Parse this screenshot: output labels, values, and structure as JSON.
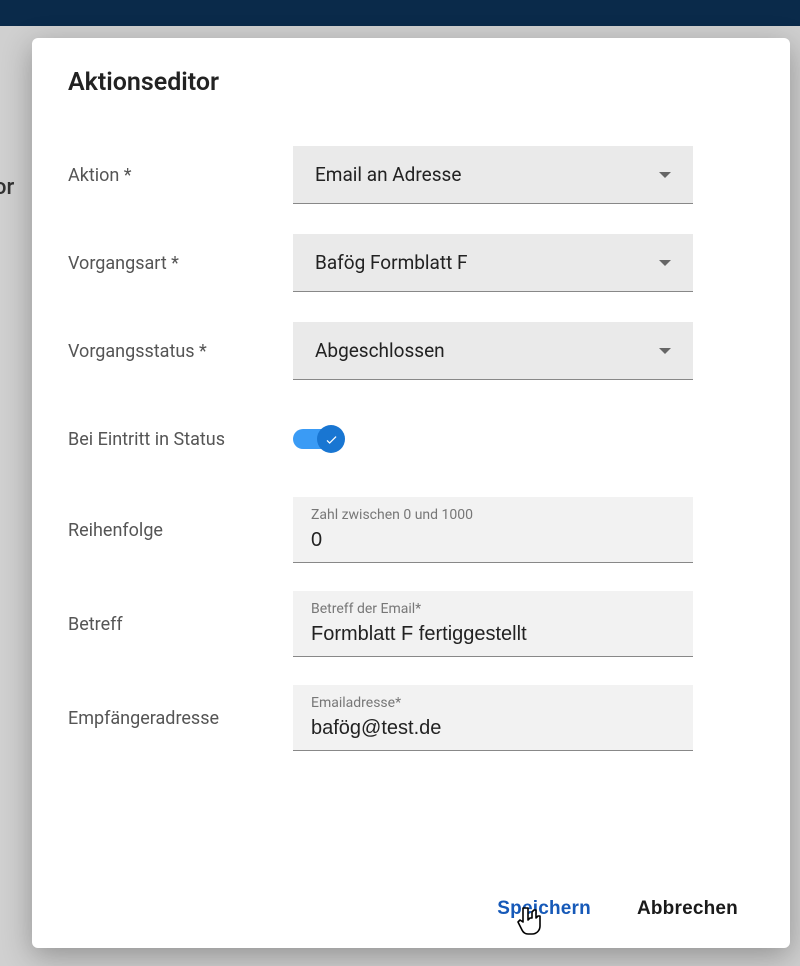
{
  "modal": {
    "title": "Aktionseditor",
    "fields": {
      "aktion": {
        "label": "Aktion *",
        "value": "Email an Adresse"
      },
      "vorgangsart": {
        "label": "Vorgangsart *",
        "value": "Bafög Formblatt F"
      },
      "vorgangsstatus": {
        "label": "Vorgangsstatus *",
        "value": "Abgeschlossen"
      },
      "eintritt": {
        "label": "Bei Eintritt in Status",
        "checked": true
      },
      "reihenfolge": {
        "label": "Reihenfolge",
        "floating": "Zahl zwischen 0 und 1000",
        "value": "0"
      },
      "betreff": {
        "label": "Betreff",
        "floating": "Betreff der Email*",
        "value": "Formblatt F fertiggestellt"
      },
      "empfaenger": {
        "label": "Empfängeradresse",
        "floating": "Emailadresse*",
        "value": "bafög@test.de"
      }
    },
    "buttons": {
      "save": "Speichern",
      "cancel": "Abbrechen"
    }
  },
  "backdrop_fragment": "or"
}
